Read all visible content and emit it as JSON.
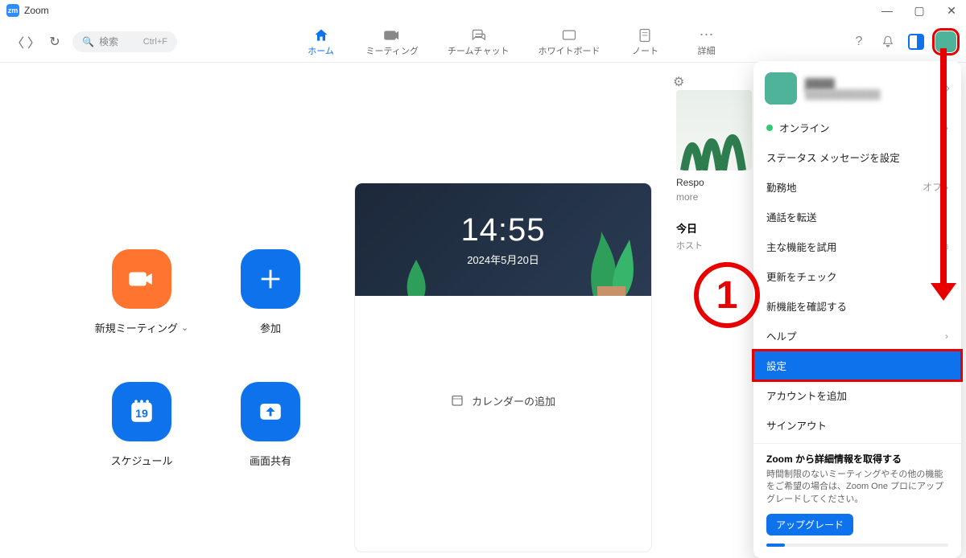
{
  "app": {
    "title": "Zoom",
    "logo_text": "zm"
  },
  "window": {
    "minimize": "—",
    "maximize": "▢",
    "close": "✕"
  },
  "toolbar": {
    "search_placeholder": "検索",
    "search_shortcut": "Ctrl+F"
  },
  "nav": {
    "home": "ホーム",
    "meeting": "ミーティング",
    "teamchat": "チームチャット",
    "whiteboard": "ホワイトボード",
    "note": "ノート",
    "more": "詳細"
  },
  "actions": {
    "new_meeting": "新規ミーティング",
    "join": "参加",
    "schedule": "スケジュール",
    "share_screen": "画面共有",
    "calendar_day": "19"
  },
  "clock": {
    "time": "14:55",
    "date": "2024年5月20日",
    "add_calendar": "カレンダーの追加"
  },
  "side": {
    "respond": "Respo",
    "more": "more",
    "today": "今日",
    "host": "ホスト"
  },
  "menu": {
    "profile_name": "████",
    "profile_email": "████████████",
    "online": "オンライン",
    "set_status": "ステータス メッセージを設定",
    "work_location": "勤務地",
    "work_location_value": "オフ",
    "forward_calls": "通話を転送",
    "try_features": "主な機能を試用",
    "check_updates": "更新をチェック",
    "whats_new": "新機能を確認する",
    "help": "ヘルプ",
    "settings": "設定",
    "add_account": "アカウントを追加",
    "sign_out": "サインアウト"
  },
  "promo": {
    "title": "Zoom から詳細情報を取得する",
    "body": "時間制限のないミーティングやその他の機能をご希望の場合は、Zoom One プロにアップグレードしてください。",
    "button": "アップグレード"
  },
  "annotation": {
    "number": "1"
  }
}
